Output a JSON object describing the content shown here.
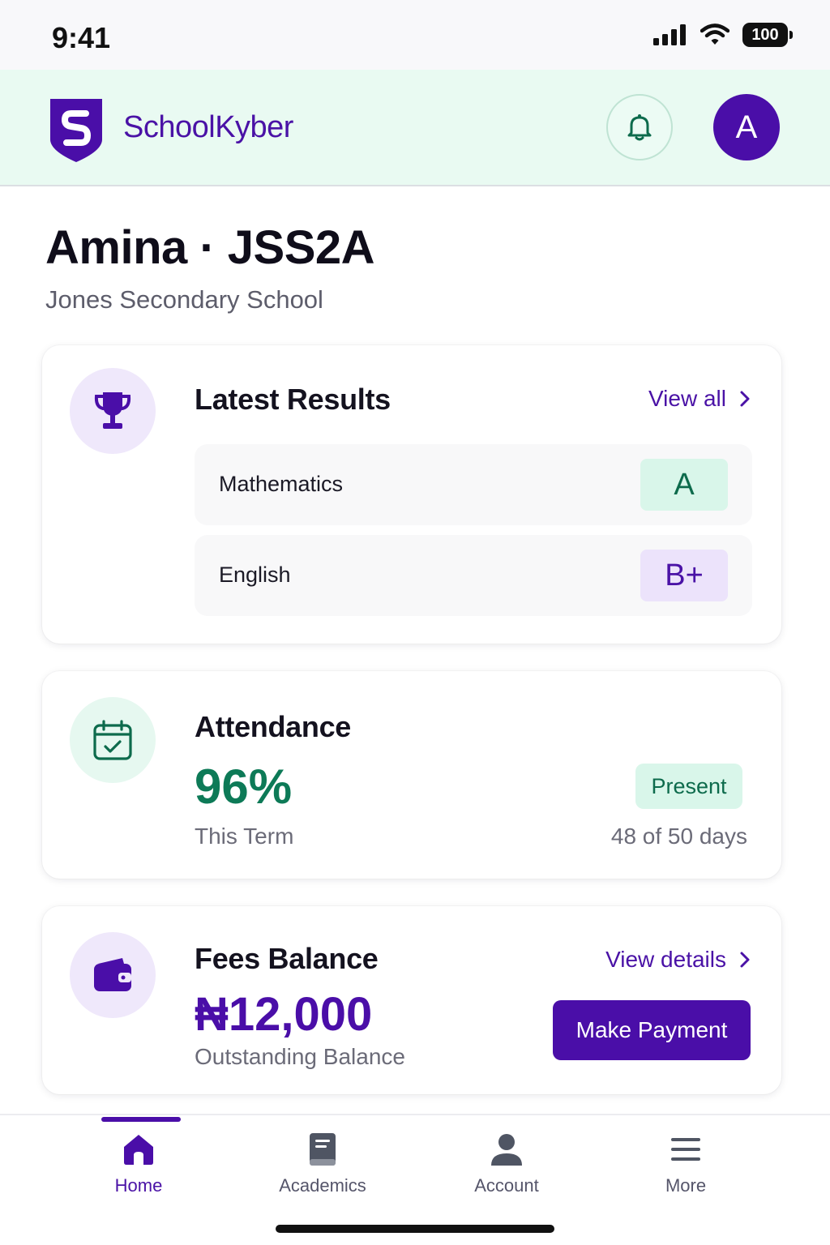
{
  "status_bar": {
    "time": "9:41",
    "battery": "100"
  },
  "header": {
    "brand": "SchoolKyber",
    "avatar_initial": "A"
  },
  "student": {
    "name": "Amina · JSS2A",
    "school": "Jones Secondary School"
  },
  "results": {
    "title": "Latest Results",
    "link": "View all",
    "rows": [
      {
        "subject": "Mathematics",
        "grade": "A"
      },
      {
        "subject": "English",
        "grade": "B+"
      }
    ]
  },
  "attendance": {
    "title": "Attendance",
    "percent": "96%",
    "period": "This Term",
    "status": "Present",
    "days": "48 of 50 days"
  },
  "fees": {
    "title": "Fees Balance",
    "link": "View details",
    "amount": "₦12,000",
    "label": "Outstanding Balance",
    "button": "Make Payment"
  },
  "nav": {
    "home": "Home",
    "academics": "Academics",
    "account": "Account",
    "more": "More"
  },
  "colors": {
    "brand_purple": "#4a0ea8",
    "success_green": "#0d7a57",
    "header_bg": "#e9faf2"
  }
}
